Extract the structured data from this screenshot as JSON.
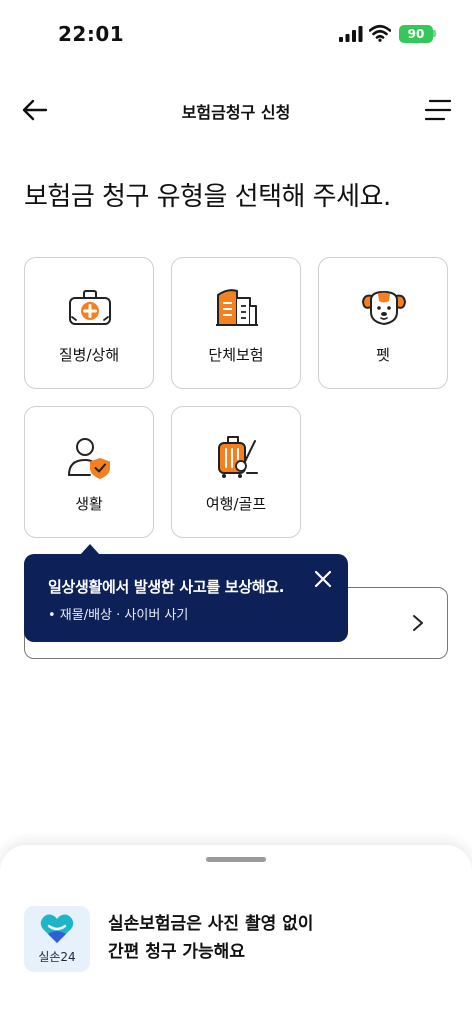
{
  "status_bar": {
    "time": "22:01",
    "battery": "90",
    "icons": [
      "signal-icon",
      "wifi-icon",
      "battery-icon"
    ]
  },
  "header": {
    "title": "보험금청구 신청",
    "icons": [
      "back-arrow-icon",
      "menu-icon"
    ]
  },
  "page_title": "보험금 청구 유형을 선택해 주세요.",
  "claim_types": [
    {
      "label": "질병/상해",
      "icon": "first-aid-kit-icon"
    },
    {
      "label": "단체보험",
      "icon": "office-building-icon"
    },
    {
      "label": "펫",
      "icon": "dog-face-icon"
    },
    {
      "label": "생활",
      "icon": "person-shield-icon"
    },
    {
      "label": "여행/골프",
      "icon": "luggage-golf-icon"
    }
  ],
  "tooltip": {
    "title": "일상생활에서 발생한 사고를 보상해요.",
    "bullet": "•  재물/배상 · 사이버 사기",
    "icon": "close-icon"
  },
  "bottom_sheet": {
    "app_name": "실손24",
    "line1": "실손보험금은 사진 촬영 없이",
    "line2": "간편 청구 가능해요",
    "icon": "heart-logo-icon"
  },
  "colors": {
    "accent_orange": "#f4801f",
    "tooltip_navy": "#0d2158",
    "battery_green": "#34c759",
    "logo_teal": "#1fb5c9",
    "logo_blue": "#2e5fd8"
  }
}
